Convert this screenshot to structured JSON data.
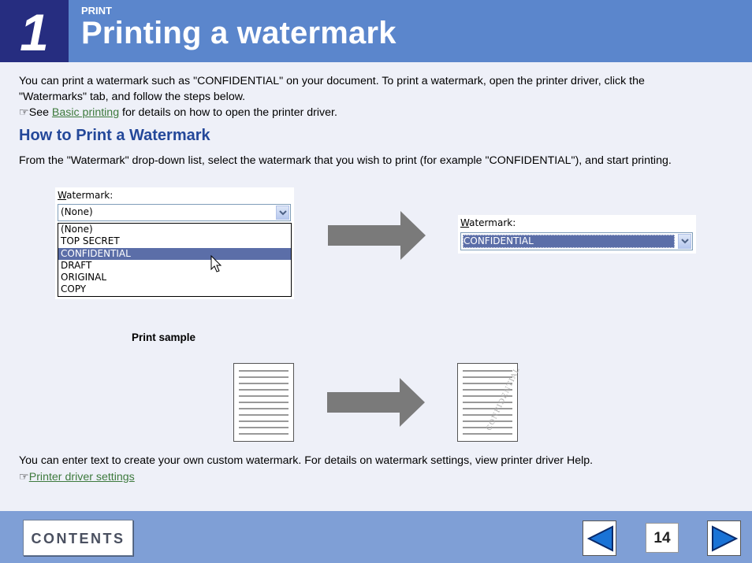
{
  "header": {
    "chapter_number": "1",
    "section": "PRINT",
    "title": "Printing a watermark"
  },
  "intro": {
    "line1": "You can print a watermark such as \"CONFIDENTIAL\" on your document. To print a watermark, open the printer driver, click the",
    "line2": "\"Watermarks\" tab, and follow the steps below.",
    "see_prefix": "See ",
    "see_link": "Basic printing",
    "see_suffix": " for details on how to open the printer driver."
  },
  "section_heading": "How to Print a Watermark",
  "instruction": "From the \"Watermark\" drop-down list, select the watermark that you wish to print (for example \"CONFIDENTIAL\"), and start printing.",
  "dropdown_before": {
    "label_ul": "W",
    "label_rest": "atermark:",
    "value": "(None)",
    "options": [
      "(None)",
      "TOP SECRET",
      "CONFIDENTIAL",
      "DRAFT",
      "ORIGINAL",
      "COPY"
    ],
    "highlighted": "CONFIDENTIAL"
  },
  "dropdown_after": {
    "label_ul": "W",
    "label_rest": "atermark:",
    "value": "CONFIDENTIAL"
  },
  "print_sample_label": "Print sample",
  "watermark_sample_text": "CONFIDENTIAL",
  "custom": {
    "text": "You can enter text to create your own custom watermark. For details on watermark settings, view printer driver Help.",
    "link": "Printer driver settings"
  },
  "reference_icon": "☞",
  "footer": {
    "contents_label": "CONTENTS",
    "page_number": "14",
    "prev_icon": "left-triangle",
    "next_icon": "right-triangle"
  },
  "colors": {
    "header_bg": "#5b86cc",
    "chapter_bg": "#262d80",
    "heading": "#24489a",
    "link": "#3d7a3d",
    "footer_bg": "#7f9fd6",
    "nav_arrow": "#1a73d6"
  }
}
